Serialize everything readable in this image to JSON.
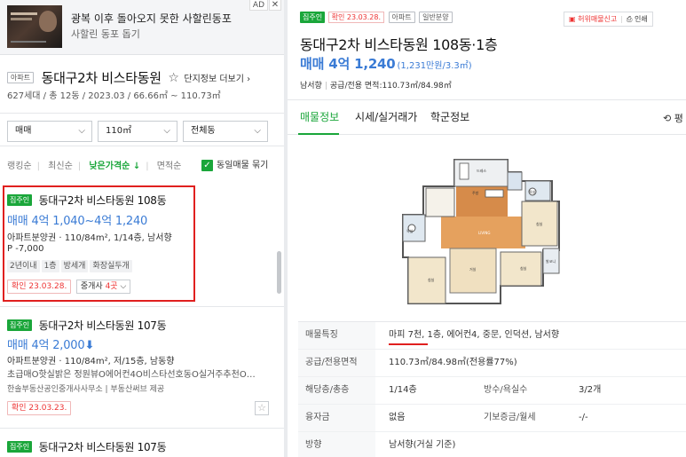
{
  "ad": {
    "title": "광복 이후 돌아오지 못한 사할린동포",
    "subtitle": "사할린 동포 돕기",
    "ad_label": "AD",
    "close": "✕"
  },
  "complex": {
    "type_tag": "아파트",
    "name": "동대구2차 비스타동원",
    "more_label": "단지정보 더보기",
    "meta": "627세대 / 총 12동 / 2023.03 / 66.66㎡ ~ 110.73㎡"
  },
  "filters": {
    "trade": "매매",
    "area": "110㎡",
    "dong": "전체동"
  },
  "sort": {
    "items": [
      "랭킹순",
      "최신순",
      "낮은가격순 ↓",
      "면적순"
    ],
    "active_index": 2,
    "group_label": "동일매물 묶기"
  },
  "listings": [
    {
      "badge": "집주인",
      "title": "동대구2차 비스타동원 108동",
      "price": "매매 4억 1,040~4억 1,240",
      "info1": "아파트분양권 · 110/84m², 1/14층, 남서향",
      "info2": "P -7,000",
      "chips": [
        "2년이내",
        "1층",
        "방세개",
        "화장실두개"
      ],
      "confirm": "확인 23.03.28.",
      "broker_prefix": "중개사 ",
      "broker_count": "4곳",
      "broker_suffix": "⌵"
    },
    {
      "badge": "집주인",
      "title": "동대구2차 비스타동원 107동",
      "price": "매매 4억 2,000",
      "price_arrow": "⬇",
      "info1": "아파트분양권 · 110/84m², 저/15층, 남동향",
      "info2": "초급매O핫실밝은 정원뷰O에어컨4O비스타선호동O실거주추천O…",
      "agency": "한솔부동산공인중개사사무소 | 부동산써브 제공",
      "confirm": "확인 23.03.23."
    },
    {
      "badge": "집주인",
      "title": "동대구2차 비스타동원 107동"
    }
  ],
  "detail": {
    "confirm": "확인 23.03.28.",
    "tags": [
      "집주인",
      "아파트",
      "일반분양"
    ],
    "report_label": "허위매물신고",
    "print_label": "인쇄",
    "title": "동대구2차 비스타동원 108동·1층",
    "price": "매매 4억 1,240",
    "price_per": "(1,231만원/3.3㎡)",
    "direction": "남서향",
    "area_label": "공급/전용 면적:110.73㎡/84.98㎡",
    "tabs": [
      "매물정보",
      "시세/실거래가",
      "학군정보"
    ],
    "refresh_label": "평",
    "floorplan_rooms": [
      "침실1",
      "침실2",
      "침실3",
      "침실4",
      "거실",
      "주방",
      "드레스룸",
      "욕실1",
      "욕실2"
    ],
    "table": [
      {
        "label": "매물특징",
        "value": "마피 7천, 1층, 에어컨4, 중문, 인덕션, 남서향"
      },
      {
        "label": "공급/전용면적",
        "value": "110.73㎡/84.98㎡(전용률77%)"
      },
      {
        "label": "해당층/총층",
        "value": "1/14층",
        "label2": "방수/욕실수",
        "value2": "3/2개"
      },
      {
        "label": "융자금",
        "value": "없음",
        "label2": "기보증금/월세",
        "value2": "-/-"
      },
      {
        "label": "방향",
        "value": "남서향(거실 기준)"
      }
    ]
  },
  "colors": {
    "accent_green": "#1aa63a",
    "price_blue": "#3a7bd5",
    "alert_red": "#e0201f"
  }
}
